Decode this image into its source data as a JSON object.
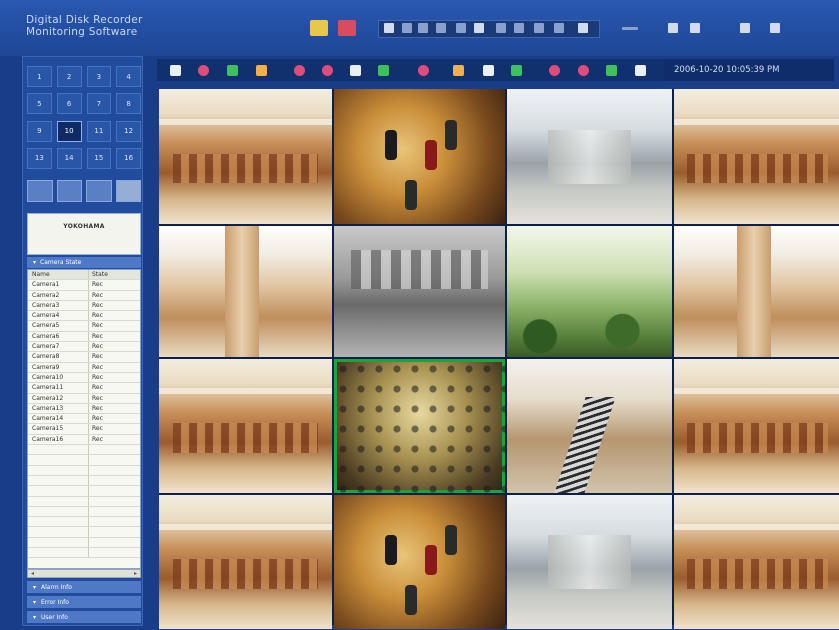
{
  "app": {
    "title_line1": "Digital Disk Recorder",
    "title_line2": "Monitoring Software"
  },
  "datetime": "2006-10-20 10:05:39 PM",
  "channels": [
    "1",
    "2",
    "3",
    "4",
    "5",
    "6",
    "7",
    "8",
    "9",
    "10",
    "11",
    "12",
    "13",
    "14",
    "15",
    "16"
  ],
  "active_channel": "10",
  "site_name": "YOKOHAMA",
  "camera_state": {
    "header": "Camera State",
    "col_name": "Name",
    "col_state": "State",
    "rows": [
      {
        "name": "Camera1",
        "state": "Rec"
      },
      {
        "name": "Camera2",
        "state": "Rec"
      },
      {
        "name": "Camera3",
        "state": "Rec"
      },
      {
        "name": "Camera4",
        "state": "Rec"
      },
      {
        "name": "Camera5",
        "state": "Rec"
      },
      {
        "name": "Camera6",
        "state": "Rec"
      },
      {
        "name": "Camera7",
        "state": "Rec"
      },
      {
        "name": "Camera8",
        "state": "Rec"
      },
      {
        "name": "Camera9",
        "state": "Rec"
      },
      {
        "name": "Camera10",
        "state": "Rec"
      },
      {
        "name": "Camera11",
        "state": "Rec"
      },
      {
        "name": "Camera12",
        "state": "Rec"
      },
      {
        "name": "Camera13",
        "state": "Rec"
      },
      {
        "name": "Camera14",
        "state": "Rec"
      },
      {
        "name": "Camera15",
        "state": "Rec"
      },
      {
        "name": "Camera16",
        "state": "Rec"
      }
    ]
  },
  "panels": {
    "alarm_info": "Alarm Info",
    "error_info": "Error Info",
    "user_info": "User Info"
  },
  "colors": {
    "frame": "#1a3d8a",
    "selected_tile": "#1ea23c"
  }
}
